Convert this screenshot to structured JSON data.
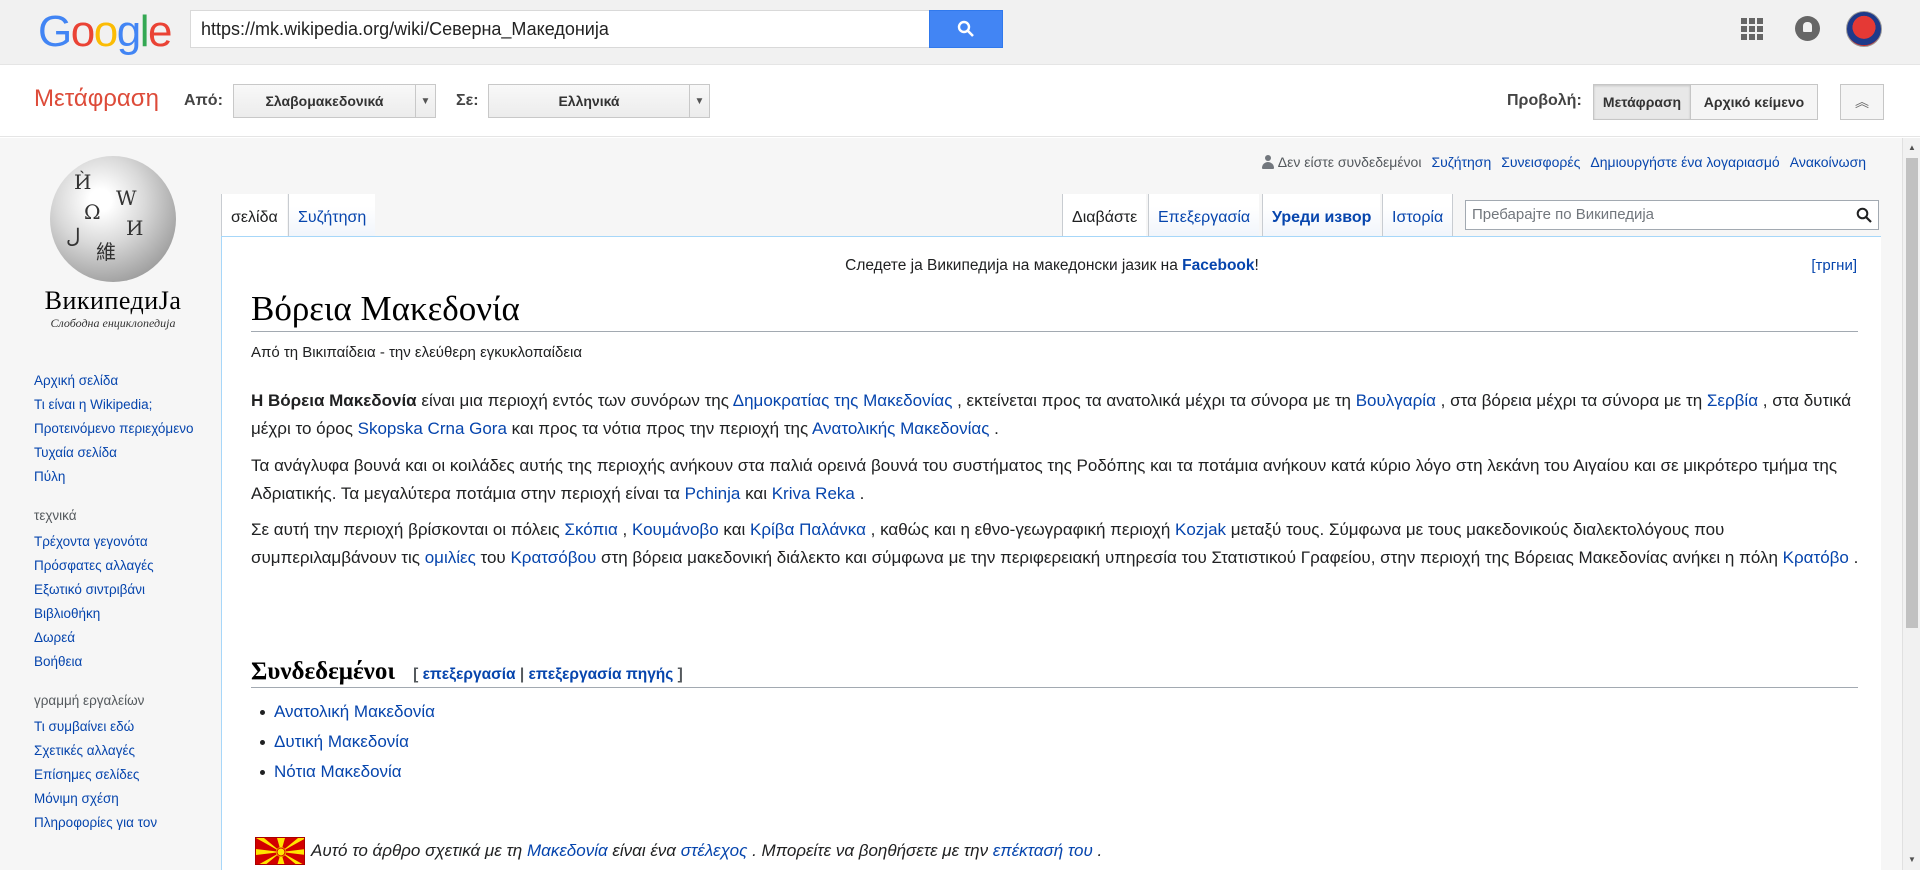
{
  "google": {
    "url": "https://mk.wikipedia.org/wiki/Северна_Македонија"
  },
  "translate": {
    "title": "Μετάφραση",
    "from_label": "Από:",
    "from_lang": "Σλαβομακεδονικά",
    "to_label": "Σε:",
    "to_lang": "Ελληνικά",
    "view_label": "Προβολή:",
    "view_translation": "Μετάφραση",
    "view_original": "Αρχικό κείμενο"
  },
  "wiki": {
    "logo_name": "ВикипедиЈа",
    "logo_tagline": "Слободна енциклопедија",
    "sidebar": {
      "nav": [
        "Αρχική σελίδα",
        "Τι είναι η Wikipedia;",
        "Προτεινόμενο περιεχόμενο",
        "Τυχαία σελίδα",
        "Πύλη"
      ],
      "section1": "τεχνικά",
      "tech": [
        "Τρέχοντα γεγονότα",
        "Πρόσφατες αλλαγές",
        "Εξωτικό σιντριβάνι",
        "Βιβλιοθήκη",
        "Δωρεά",
        "Βοήθεια"
      ],
      "section2": "γραμμή εργαλείων",
      "tools": [
        "Τι συμβαίνει εδώ",
        "Σχετικές αλλαγές",
        "Επίσημες σελίδες",
        "Μόνιμη σχέση",
        "Πληροφορίες για τον"
      ]
    },
    "personal": {
      "anon": "Δεν είστε συνδεδεμένοι",
      "talk": "Συζήτηση",
      "contribs": "Συνεισφορές",
      "create": "Δημιουργήστε ένα λογαριασμό",
      "login": "Ανακοίνωση"
    },
    "tabs": {
      "page": "σελίδα",
      "talk": "Συζήτηση",
      "read": "Διαβάστε",
      "edit": "Επεξεργασία",
      "edit_source": "Уреди извор",
      "history": "Ιστορία"
    },
    "search_placeholder": "Пребарајте по Википедија",
    "banner": {
      "text": "Следете ја Википедија на македонски јазик на ",
      "link": "Facebook",
      "end": "!",
      "hide": "[тргни]"
    },
    "title": "Βόρεια Μακεδονία",
    "tagline": "Από τη Βικιπαίδεια - την ελεύθερη εγκυκλοπαίδεια",
    "p1": {
      "bold": "Η Βόρεια Μακεδονία",
      "t1": " είναι μια περιοχή εντός των συνόρων της ",
      "l1": "Δημοκρατίας της Μακεδονίας",
      "t2": " , εκτείνεται προς τα ανατολικά μέχρι τα σύνορα με τη ",
      "l2": "Βουλγαρία",
      "t3": " , στα βόρεια μέχρι τα σύνορα με τη ",
      "l3": "Σερβία",
      "t4": " , στα δυτικά μέχρι το όρος ",
      "l4": "Skopska Crna Gora",
      "t5": " και προς τα νότια προς την περιοχή της ",
      "l5": "Ανατολικής Μακεδονίας",
      "t6": " ."
    },
    "p2": {
      "t1": "Τα ανάγλυφα βουνά και οι κοιλάδες αυτής της περιοχής ανήκουν στα παλιά ορεινά βουνά του συστήματος της Ροδόπης και τα ποτάμια ανήκουν κατά κύριο λόγο στη λεκάνη του Αιγαίου και σε μικρότερο τμήμα της Αδριατικής. Τα μεγαλύτερα ποτάμια στην περιοχή είναι τα ",
      "l1": "Pchinja",
      "t2": " και ",
      "l2": "Kriva Reka",
      "t3": " ."
    },
    "p3": {
      "t1": "Σε αυτή την περιοχή βρίσκονται οι πόλεις ",
      "l1": "Σκόπια",
      "t2": " , ",
      "l2": "Κουμάνοβο",
      "t3": " και ",
      "l3": "Κρίβα Παλάνκα",
      "t4": " , καθώς και η εθνο-γεωγραφική περιοχή ",
      "l4": "Kozjak",
      "t5": " μεταξύ τους. Σύμφωνα με τους μακεδονικούς διαλεκτολόγους που συμπεριλαμβάνουν τις ",
      "l5": "ομιλίες",
      "t6": " του ",
      "l6": "Κρατσόβου",
      "t7": " στη βόρεια μακεδονική διάλεκτο και σύμφωνα με την περιφερειακή υπηρεσία του Στατιστικού Γραφείου, στην περιοχή της Βόρειας Μακεδονίας ανήκει η πόλη ",
      "l7": "Κρατόβο",
      "t8": " ."
    },
    "section": {
      "title": "Συνδεδεμένοι",
      "open": "[ ",
      "edit": "επεξεργασία",
      "sep": " | ",
      "edit_source": "επεξεργασία πηγής",
      "close": " ]"
    },
    "related": [
      "Ανατολική Μακεδονία",
      "Δυτική Μακεδονία",
      "Νότια Μακεδονία"
    ],
    "stub": {
      "t1": "Αυτό το άρθρο σχετικά με τη ",
      "l1": "Μακεδονία",
      "t2": " είναι ένα ",
      "l2": "στέλεχος",
      "t3": " . Μπορείτε να βοηθήσετε με την ",
      "l3": "επέκτασή του",
      "t4": " ."
    }
  },
  "colors": {
    "google_blue": "#4285f4",
    "translate_red": "#dd4b39",
    "wiki_link": "#0645ad",
    "flag_red": "#d20000",
    "flag_yellow": "#ffe600"
  }
}
